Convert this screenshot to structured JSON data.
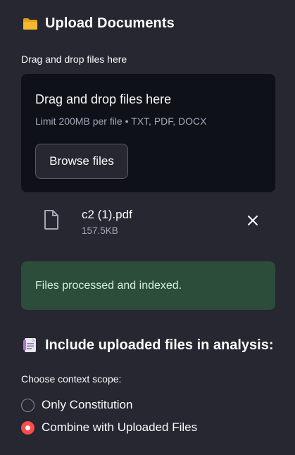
{
  "upload_section": {
    "title": "Upload Documents",
    "icon": "folder-icon"
  },
  "uploader": {
    "label": "Drag and drop files here",
    "dropzone_title": "Drag and drop files here",
    "dropzone_limit": "Limit 200MB per file • TXT, PDF, DOCX",
    "browse_label": "Browse files"
  },
  "uploaded_file": {
    "name": "c2 (1).pdf",
    "size": "157.5KB",
    "icon": "file-icon",
    "remove_icon": "close-icon"
  },
  "status": {
    "message": "Files processed and indexed.",
    "color": "#2b4d3a"
  },
  "analysis_section": {
    "title": "Include uploaded files in analysis:",
    "icon": "document-icon"
  },
  "context_scope": {
    "label": "Choose context scope:",
    "options": [
      {
        "label": "Only Constitution",
        "selected": false
      },
      {
        "label": "Combine with Uploaded Files",
        "selected": true
      }
    ],
    "accent_color": "#ff4b4b"
  }
}
